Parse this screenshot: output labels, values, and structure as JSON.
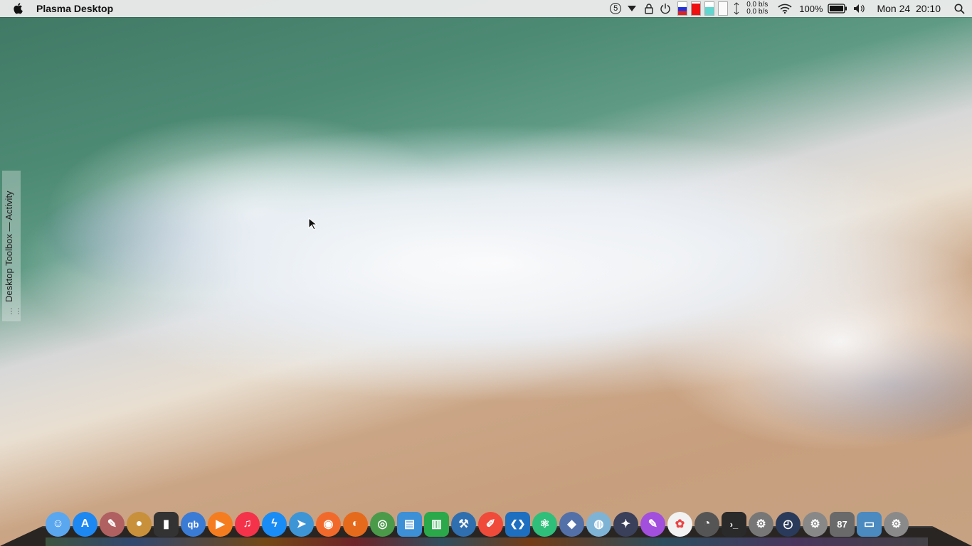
{
  "menubar": {
    "app_title": "Plasma Desktop",
    "badge_number": "5",
    "net_down": "0.0 b/s",
    "net_up": "0.0 b/s",
    "battery_percent": "100%",
    "clock": "Mon 24  20:10"
  },
  "toolbox": {
    "label": "Desktop Toolbox — Activity"
  },
  "dock": {
    "items": [
      {
        "name": "finder",
        "glyph": "☺",
        "color": "#5aa7f0"
      },
      {
        "name": "app-store",
        "glyph": "A",
        "color": "#1e88f2"
      },
      {
        "name": "notes",
        "glyph": "✎",
        "color": "#b06060"
      },
      {
        "name": "contacts",
        "glyph": "●",
        "color": "#c8903a"
      },
      {
        "name": "phone",
        "glyph": "▮",
        "color": "#333333"
      },
      {
        "name": "qbittorrent",
        "glyph": "qb",
        "color": "#3a7bd5"
      },
      {
        "name": "infuse",
        "glyph": "▶",
        "color": "#f57c1f"
      },
      {
        "name": "music",
        "glyph": "♫",
        "color": "#f4324a"
      },
      {
        "name": "messenger",
        "glyph": "ϟ",
        "color": "#1a8cf5"
      },
      {
        "name": "telegram",
        "glyph": "➤",
        "color": "#3d95d6"
      },
      {
        "name": "rss",
        "glyph": "◉",
        "color": "#f26a2b"
      },
      {
        "name": "firefox",
        "glyph": "◐",
        "color": "#e66a1c"
      },
      {
        "name": "chrome",
        "glyph": "◎",
        "color": "#4a9a4a"
      },
      {
        "name": "preview",
        "glyph": "▤",
        "color": "#3d8fd6"
      },
      {
        "name": "numbers",
        "glyph": "▥",
        "color": "#2aa84a"
      },
      {
        "name": "xcode",
        "glyph": "⚒",
        "color": "#2f6fb0"
      },
      {
        "name": "pencil",
        "glyph": "✐",
        "color": "#f04a3a"
      },
      {
        "name": "vscode",
        "glyph": "❮❯",
        "color": "#1f6fc0"
      },
      {
        "name": "atom",
        "glyph": "⚛",
        "color": "#2fbf7a"
      },
      {
        "name": "kdeconnect",
        "glyph": "◆",
        "color": "#5470a8"
      },
      {
        "name": "mirror",
        "glyph": "◍",
        "color": "#7fb3d6"
      },
      {
        "name": "safari",
        "glyph": "✦",
        "color": "#3a3f5a"
      },
      {
        "name": "brush",
        "glyph": "✎",
        "color": "#a24fdd"
      },
      {
        "name": "photos",
        "glyph": "✿",
        "color": "#f2f2f2"
      },
      {
        "name": "photoscape",
        "glyph": "◔",
        "color": "#555555"
      },
      {
        "name": "terminal",
        "glyph": "›_",
        "color": "#2a2a2a"
      },
      {
        "name": "settings-1",
        "glyph": "⚙",
        "color": "#777777"
      },
      {
        "name": "speedometer",
        "glyph": "◴",
        "color": "#2a3a5a"
      },
      {
        "name": "settings-2",
        "glyph": "⚙",
        "color": "#888888"
      },
      {
        "name": "trash",
        "glyph": "87",
        "color": "#6a6a6a"
      },
      {
        "name": "folder",
        "glyph": "▭",
        "color": "#4a8ac0"
      },
      {
        "name": "settings-3",
        "glyph": "⚙",
        "color": "#8a8a8a"
      }
    ]
  }
}
